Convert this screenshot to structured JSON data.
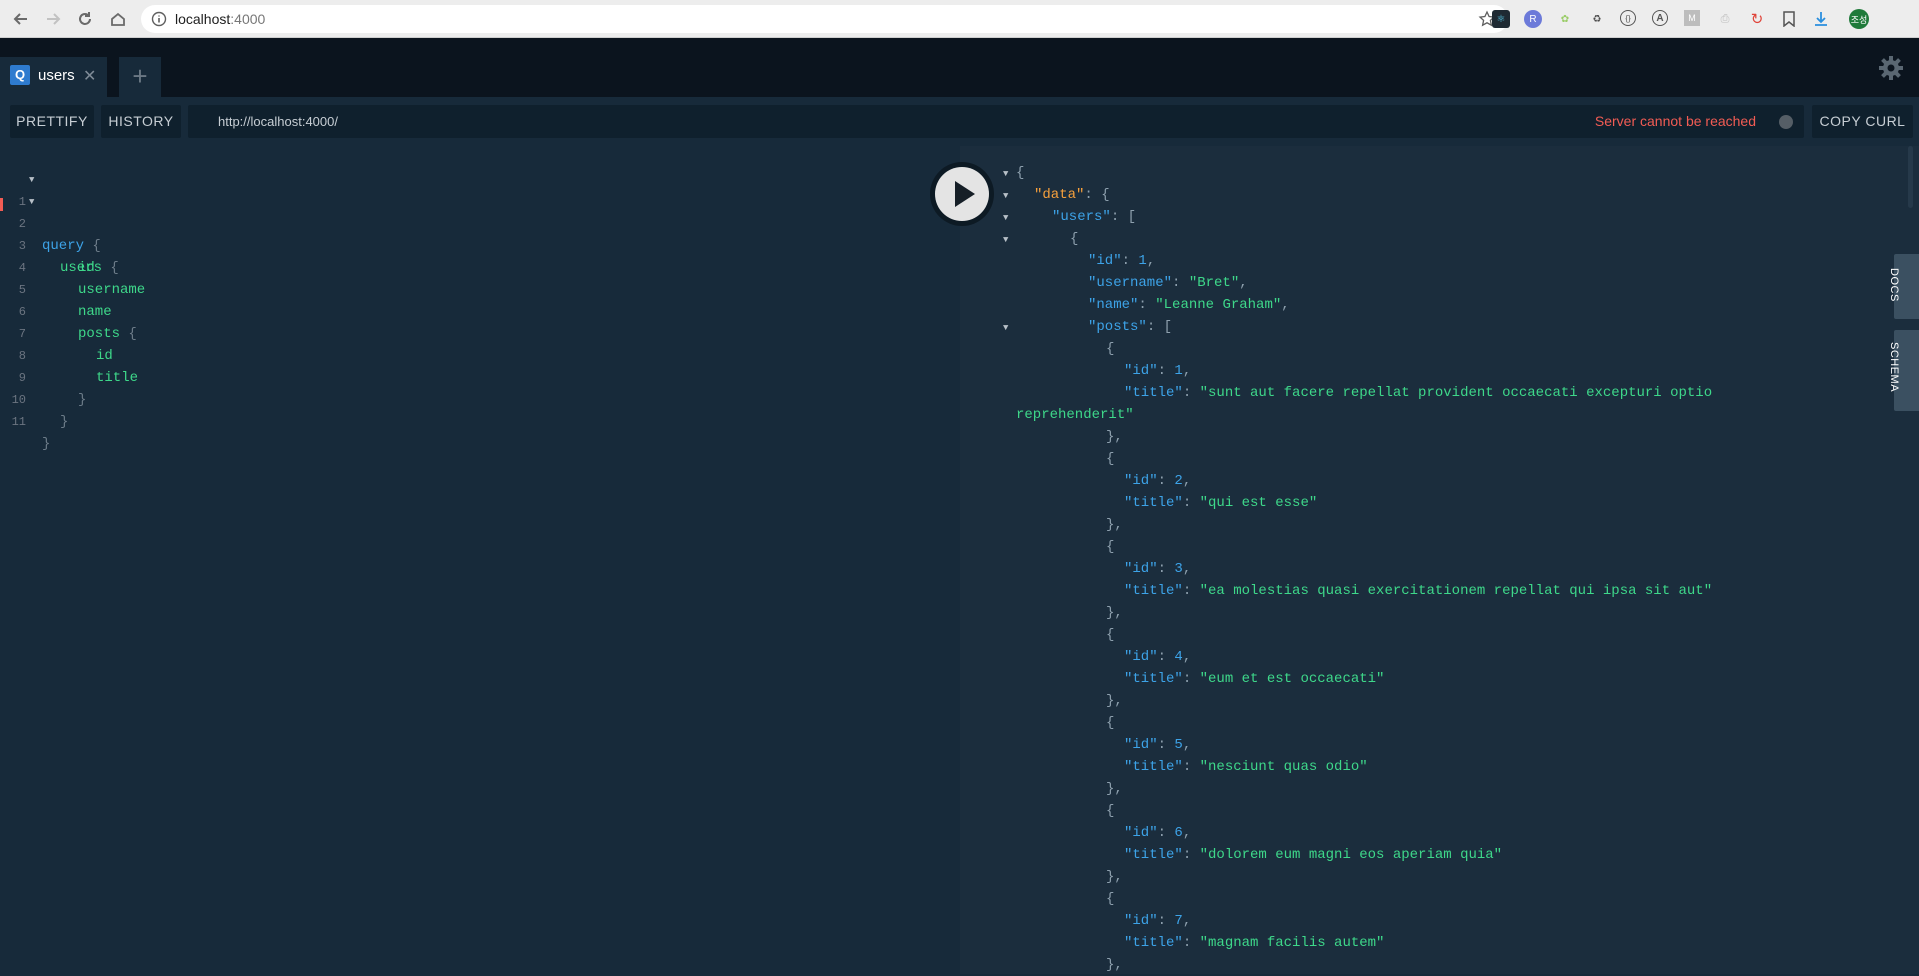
{
  "browser": {
    "url_host": "localhost",
    "url_port": ":4000",
    "extensions": [
      "react-devtools-icon",
      "redux-icon",
      "color-picker-icon",
      "recycle-icon",
      "code-icon",
      "at-icon",
      "m-icon",
      "pdf-icon",
      "refresh-ext-icon",
      "bookmark-icon",
      "download-icon"
    ],
    "profile": "조성"
  },
  "tabs": [
    {
      "badge": "Q",
      "label": "users",
      "close": "✕"
    }
  ],
  "add_tab": "+",
  "toolbar": {
    "prettify": "PRETTIFY",
    "history": "HISTORY",
    "endpoint": "http://localhost:4000/",
    "status": "Server cannot be reached",
    "copy_curl": "COPY CURL"
  },
  "editor": {
    "lines": [
      {
        "n": "1",
        "text": "query {"
      },
      {
        "n": "2",
        "text": "users {"
      },
      {
        "n": "3",
        "text": "id"
      },
      {
        "n": "4",
        "text": "username"
      },
      {
        "n": "5",
        "text": "name"
      },
      {
        "n": "6",
        "text": "posts {"
      },
      {
        "n": "7",
        "text": "id"
      },
      {
        "n": "8",
        "text": "title"
      },
      {
        "n": "9",
        "text": "}"
      },
      {
        "n": "10",
        "text": "}"
      },
      {
        "n": "11",
        "text": "}"
      }
    ]
  },
  "result": {
    "data_key": "\"data\"",
    "users_key": "\"users\"",
    "user": {
      "id_key": "\"id\"",
      "id": "1",
      "username_key": "\"username\"",
      "username": "\"Bret\"",
      "name_key": "\"name\"",
      "name": "\"Leanne Graham\"",
      "posts_key": "\"posts\""
    },
    "posts": [
      {
        "id": "1",
        "title": "\"sunt aut facere repellat provident occaecati excepturi optio",
        "title_cont": "reprehenderit\""
      },
      {
        "id": "2",
        "title": "\"qui est esse\""
      },
      {
        "id": "3",
        "title": "\"ea molestias quasi exercitationem repellat qui ipsa sit aut\""
      },
      {
        "id": "4",
        "title": "\"eum et est occaecati\""
      },
      {
        "id": "5",
        "title": "\"nesciunt quas odio\""
      },
      {
        "id": "6",
        "title": "\"dolorem eum magni eos aperiam quia\""
      },
      {
        "id": "7",
        "title": "\"magnam facilis autem\""
      }
    ],
    "post_id_key": "\"id\"",
    "post_title_key": "\"title\""
  },
  "side_tabs": {
    "docs": "DOCS",
    "schema": "SCHEMA"
  }
}
